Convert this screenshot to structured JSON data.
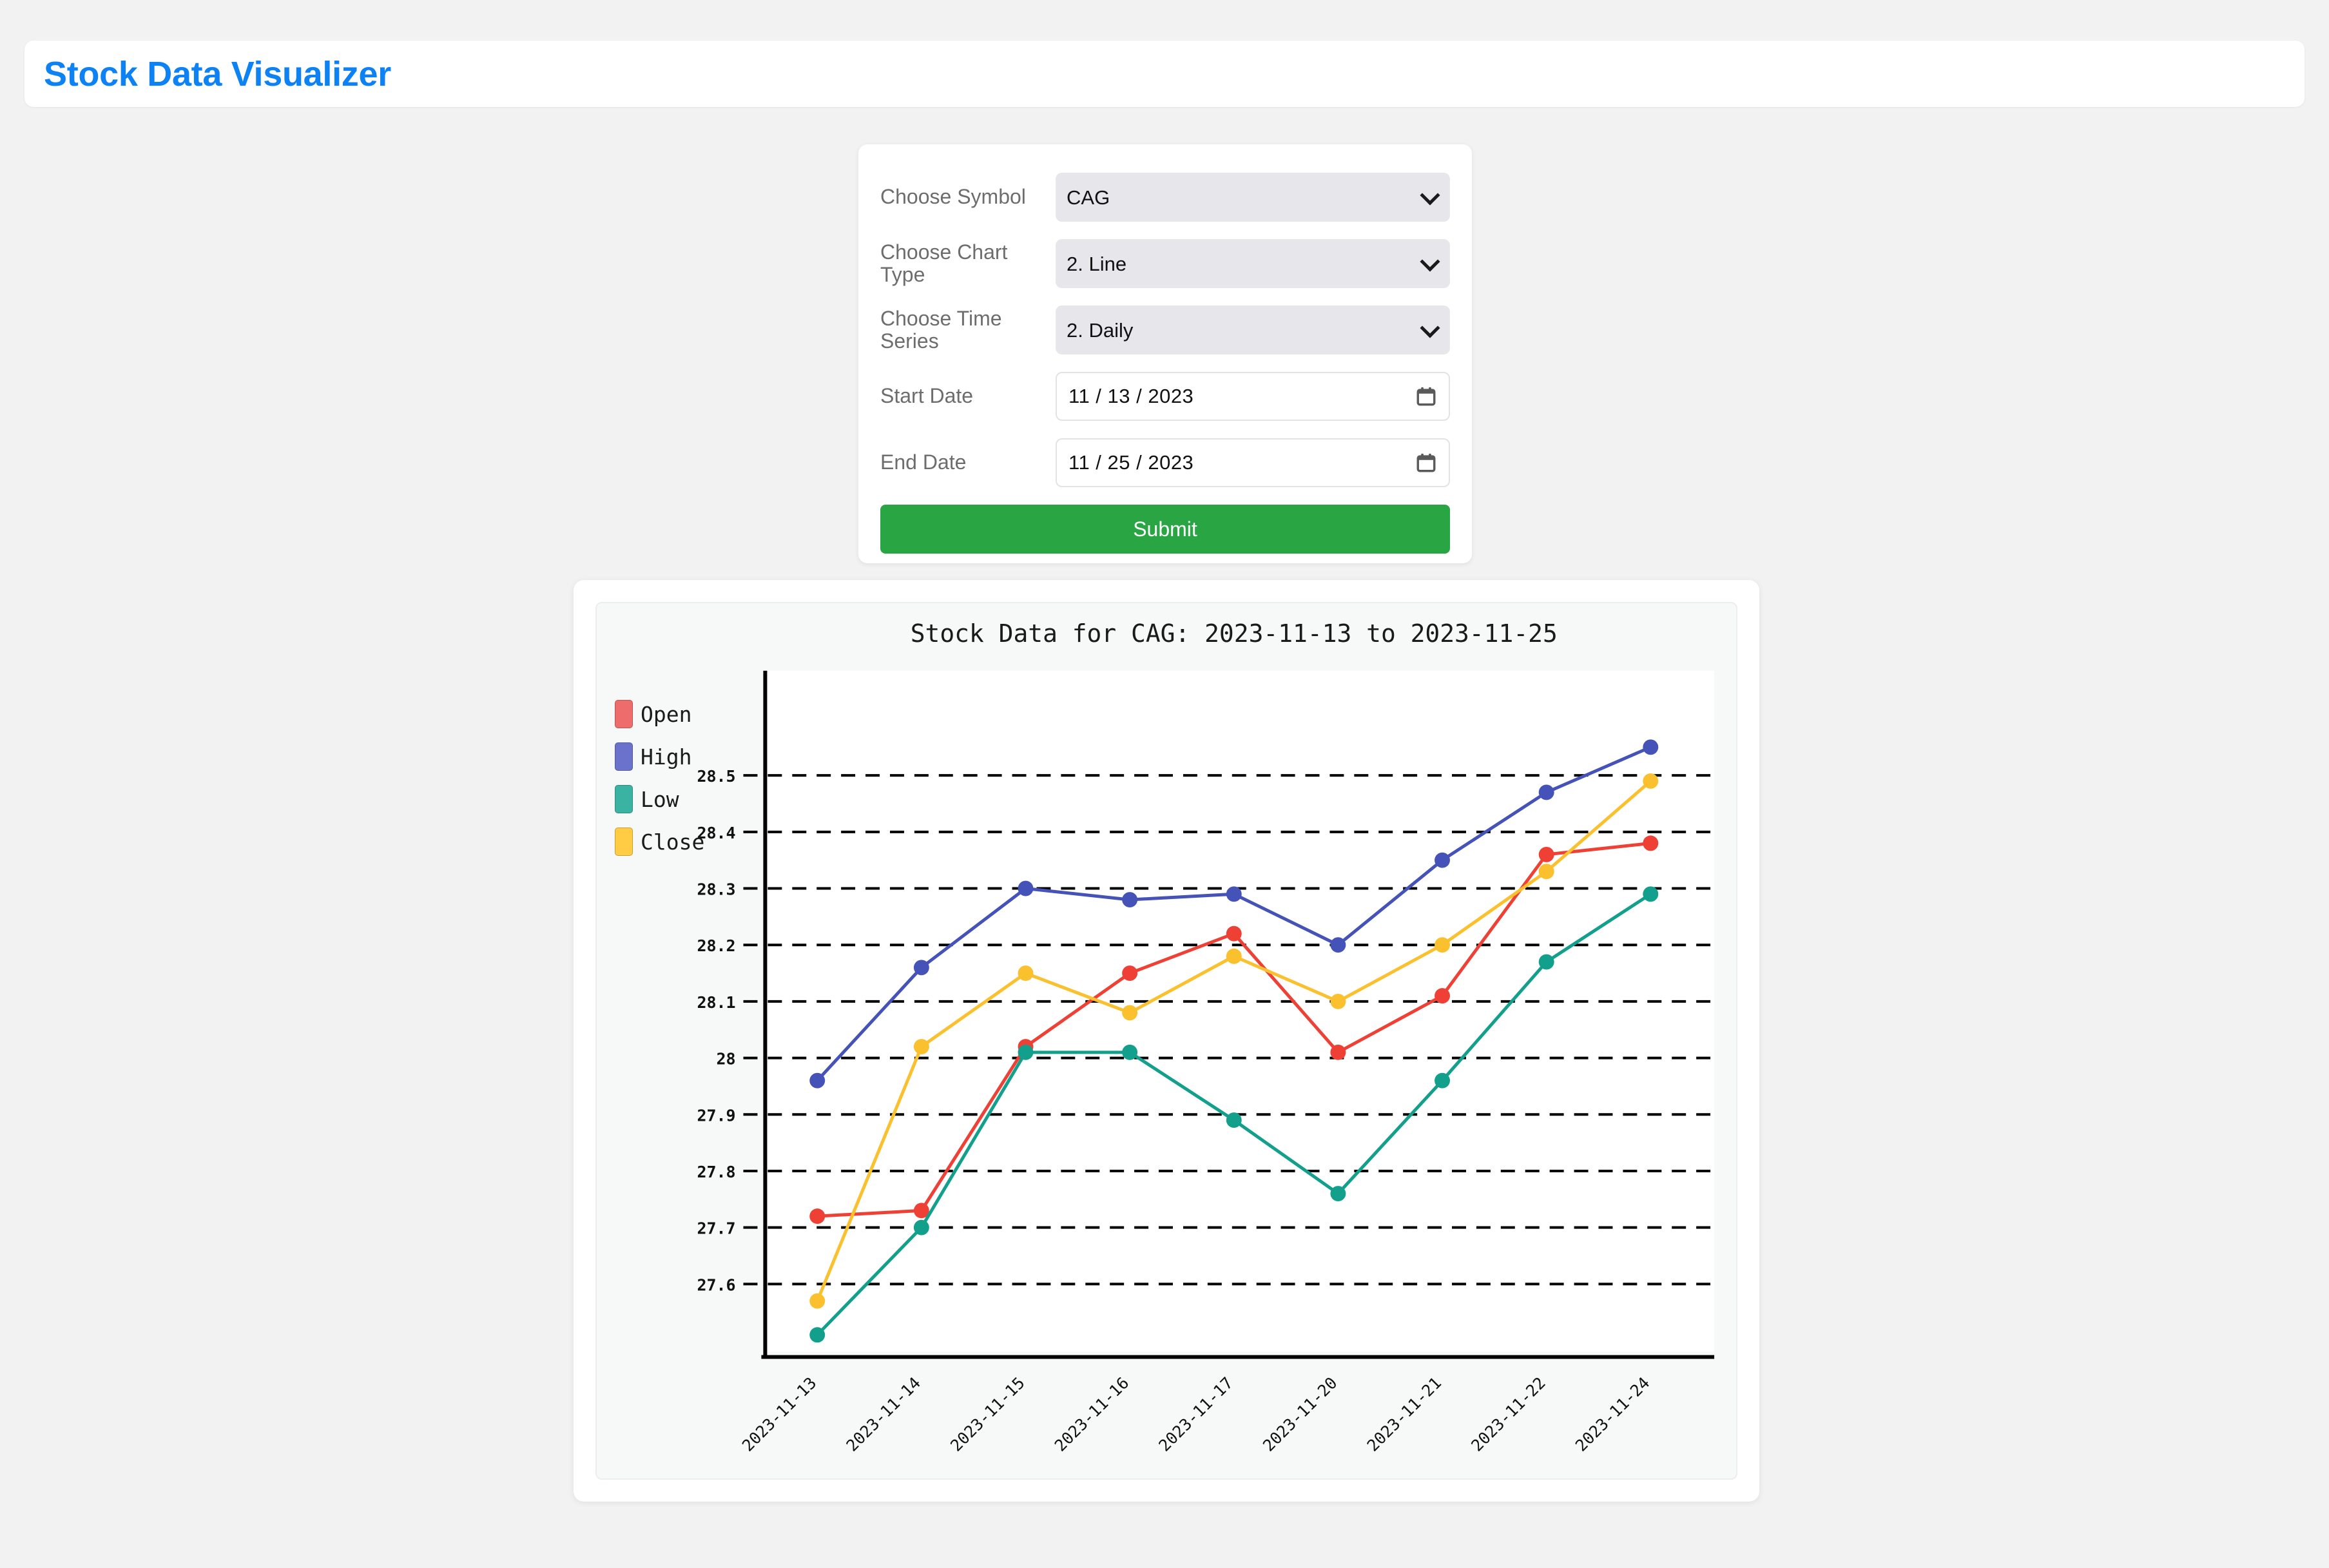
{
  "header": {
    "title": "Stock Data Visualizer",
    "accent": "#0c82f5"
  },
  "form": {
    "symbol": {
      "label": "Choose Symbol",
      "value": "CAG",
      "icon": "chevron-down-icon"
    },
    "chart_type": {
      "label": "Choose Chart Type",
      "value": "2. Line",
      "icon": "chevron-down-icon"
    },
    "time_series": {
      "label": "Choose Time Series",
      "value": "2. Daily",
      "icon": "chevron-down-icon"
    },
    "start_date": {
      "label": "Start Date",
      "value": "11 / 13 / 2023",
      "icon": "calendar-icon"
    },
    "end_date": {
      "label": "End Date",
      "value": "11 / 25 / 2023",
      "icon": "calendar-icon"
    },
    "submit": {
      "label": "Submit",
      "color": "#2aa544"
    }
  },
  "chart_data": {
    "type": "line",
    "title": "Stock Data for CAG: 2023-11-13 to 2023-11-25",
    "xlabel": "",
    "ylabel": "",
    "grid": true,
    "legend_position": "left",
    "ylim": [
      27.48,
      28.6
    ],
    "yticks": [
      "27.6",
      "27.7",
      "27.8",
      "27.9",
      "28",
      "28.1",
      "28.2",
      "28.3",
      "28.4",
      "28.5"
    ],
    "ytick_values": [
      27.6,
      27.7,
      27.8,
      27.9,
      28.0,
      28.1,
      28.2,
      28.3,
      28.4,
      28.5
    ],
    "categories": [
      "2023-11-13",
      "2023-11-14",
      "2023-11-15",
      "2023-11-16",
      "2023-11-17",
      "2023-11-20",
      "2023-11-21",
      "2023-11-22",
      "2023-11-24"
    ],
    "series": [
      {
        "name": "Open",
        "color": "#ef4036",
        "legend_color": "#ee6c6c",
        "values": [
          27.72,
          27.73,
          28.02,
          28.15,
          28.22,
          28.01,
          28.11,
          28.36,
          28.38
        ]
      },
      {
        "name": "High",
        "color": "#4553b8",
        "legend_color": "#6b72cc",
        "values": [
          27.96,
          28.16,
          28.3,
          28.28,
          28.29,
          28.2,
          28.35,
          28.47,
          28.55
        ]
      },
      {
        "name": "Low",
        "color": "#12a08c",
        "legend_color": "#3bb3a3",
        "values": [
          27.51,
          27.7,
          28.01,
          28.01,
          27.89,
          27.76,
          27.96,
          28.17,
          28.29
        ]
      },
      {
        "name": "Close",
        "color": "#fbc02d",
        "legend_color": "#ffcc44",
        "values": [
          27.57,
          28.02,
          28.15,
          28.08,
          28.18,
          28.1,
          28.2,
          28.33,
          28.49
        ]
      }
    ]
  }
}
